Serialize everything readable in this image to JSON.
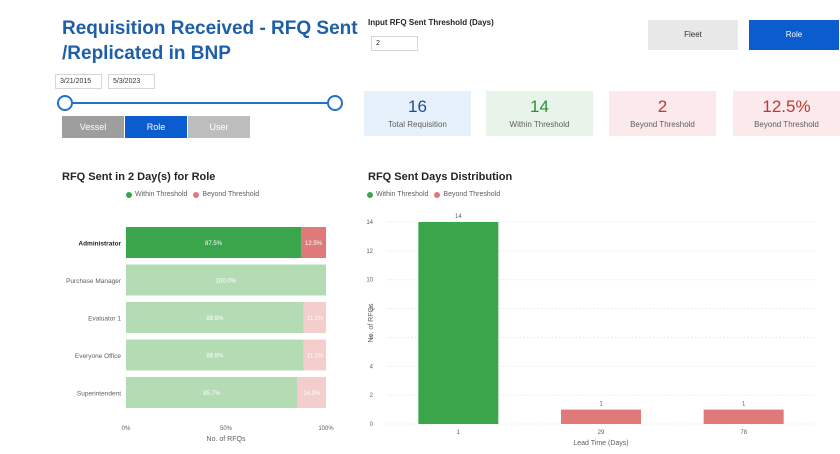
{
  "header": {
    "title_line1": "Requisition Received - RFQ Sent",
    "title_line2": "/Replicated in BNP"
  },
  "date_range": {
    "start": "3/21/2015",
    "end": "5/3/2023"
  },
  "view_toggle": {
    "options": [
      "Vessel",
      "Role",
      "User"
    ],
    "selected": "Role"
  },
  "threshold_input": {
    "label": "Input RFQ Sent Threshold (Days)",
    "value": "2"
  },
  "mode_buttons": {
    "fleet_label": "Fleet",
    "role_label": "Role"
  },
  "kpis": [
    {
      "value": "16",
      "label": "Total Requisition"
    },
    {
      "value": "14",
      "label": "Within Threshold"
    },
    {
      "value": "2",
      "label": "Beyond Threshold"
    },
    {
      "value": "12.5%",
      "label": "Beyond Threshold"
    }
  ],
  "colors": {
    "within": "#3aa54a",
    "beyond": "#e07a7a",
    "within_light": "#b4dcb4",
    "beyond_light": "#f4cdcd",
    "accent": "#0b5ccf",
    "title": "#1d5fa8"
  },
  "left_chart_text": {
    "title": "RFQ Sent in 2 Day(s) for Role",
    "legend_within": "Within Threshold",
    "legend_beyond": "Beyond Threshold",
    "xlabel": "No. of RFQs",
    "xticks": [
      "0%",
      "50%",
      "100%"
    ]
  },
  "right_chart_text": {
    "title": "RFQ Sent Days Distribution",
    "legend_within": "Within Threshold",
    "legend_beyond": "Beyond Threshold",
    "xlabel": "Lead Time (Days)",
    "ylabel": "No. of RFQs",
    "yticks": [
      "0",
      "2",
      "4",
      "6",
      "8",
      "10",
      "12",
      "14"
    ]
  },
  "chart_data": [
    {
      "type": "bar",
      "orientation": "horizontal",
      "stacked": "100%",
      "title": "RFQ Sent in 2 Day(s) for Role",
      "xlabel": "No. of RFQs",
      "categories": [
        "Administrator",
        "Purchase Manager",
        "Evaluator 1",
        "Everyone Office",
        "Superintendent"
      ],
      "series": [
        {
          "name": "Within Threshold",
          "values": [
            87.5,
            100.0,
            88.9,
            88.9,
            85.7
          ],
          "labels": [
            "87.5%",
            "100.0%",
            "88.9%",
            "88.9%",
            "85.7%"
          ]
        },
        {
          "name": "Beyond Threshold",
          "values": [
            12.5,
            0,
            11.1,
            11.1,
            14.3
          ],
          "labels": [
            "12.5%",
            "",
            "11.1%",
            "11.1%",
            "14.3%"
          ]
        }
      ],
      "highlighted_category": "Administrator",
      "xlim": [
        0,
        100
      ],
      "legend": "top"
    },
    {
      "type": "bar",
      "title": "RFQ Sent Days Distribution",
      "xlabel": "Lead Time (Days)",
      "ylabel": "No. of RFQs",
      "categories": [
        "1",
        "29",
        "78"
      ],
      "values": [
        14,
        1,
        1
      ],
      "bar_series": [
        "Within Threshold",
        "Beyond Threshold",
        "Beyond Threshold"
      ],
      "ylim": [
        0,
        14
      ],
      "legend": "top-left",
      "grid": true
    }
  ]
}
